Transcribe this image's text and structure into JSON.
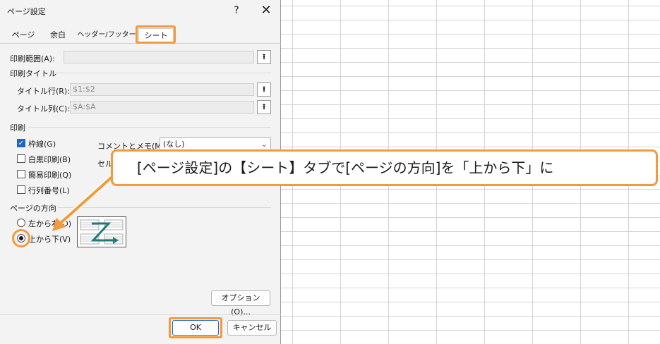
{
  "dialog": {
    "title": "ページ設定",
    "help_label": "?",
    "close_label": "✕",
    "tabs": [
      {
        "label": "ページ"
      },
      {
        "label": "余白"
      },
      {
        "label": "ヘッダー/フッター"
      },
      {
        "label": "シート"
      }
    ],
    "active_tab": "シート",
    "print_area": {
      "label": "印刷範囲(A):",
      "value": ""
    },
    "print_titles_label": "印刷タイトル",
    "title_rows": {
      "label": "タイトル行(R):",
      "value": "$1:$2"
    },
    "title_cols": {
      "label": "タイトル列(C):",
      "value": "$A:$A"
    },
    "print_section_label": "印刷",
    "checkboxes": [
      {
        "label": "枠線(G)",
        "checked": true
      },
      {
        "label": "白黒印刷(B)",
        "checked": false
      },
      {
        "label": "簡易印刷(Q)",
        "checked": false
      },
      {
        "label": "行列番号(L)",
        "checked": false
      }
    ],
    "comments": {
      "label": "コメントとメモ(M):",
      "value": "(なし)"
    },
    "cell_errors_label": "セル",
    "page_order_label": "ページの方向",
    "radios": [
      {
        "label": "左から右(D)",
        "selected": false
      },
      {
        "label": "上から下(V)",
        "selected": true
      }
    ],
    "options_button": "オプション(O)...",
    "ok_button": "OK",
    "cancel_button": "キャンセル",
    "collapse_glyph": "⭱"
  },
  "callout": {
    "text": "[ページ設定]の【シート】タブで[ページの方向]を「上から下」に"
  },
  "colors": {
    "highlight": "#f39a3c",
    "accent": "#1a66c9",
    "diagram_arrow": "#1f7a7a"
  }
}
